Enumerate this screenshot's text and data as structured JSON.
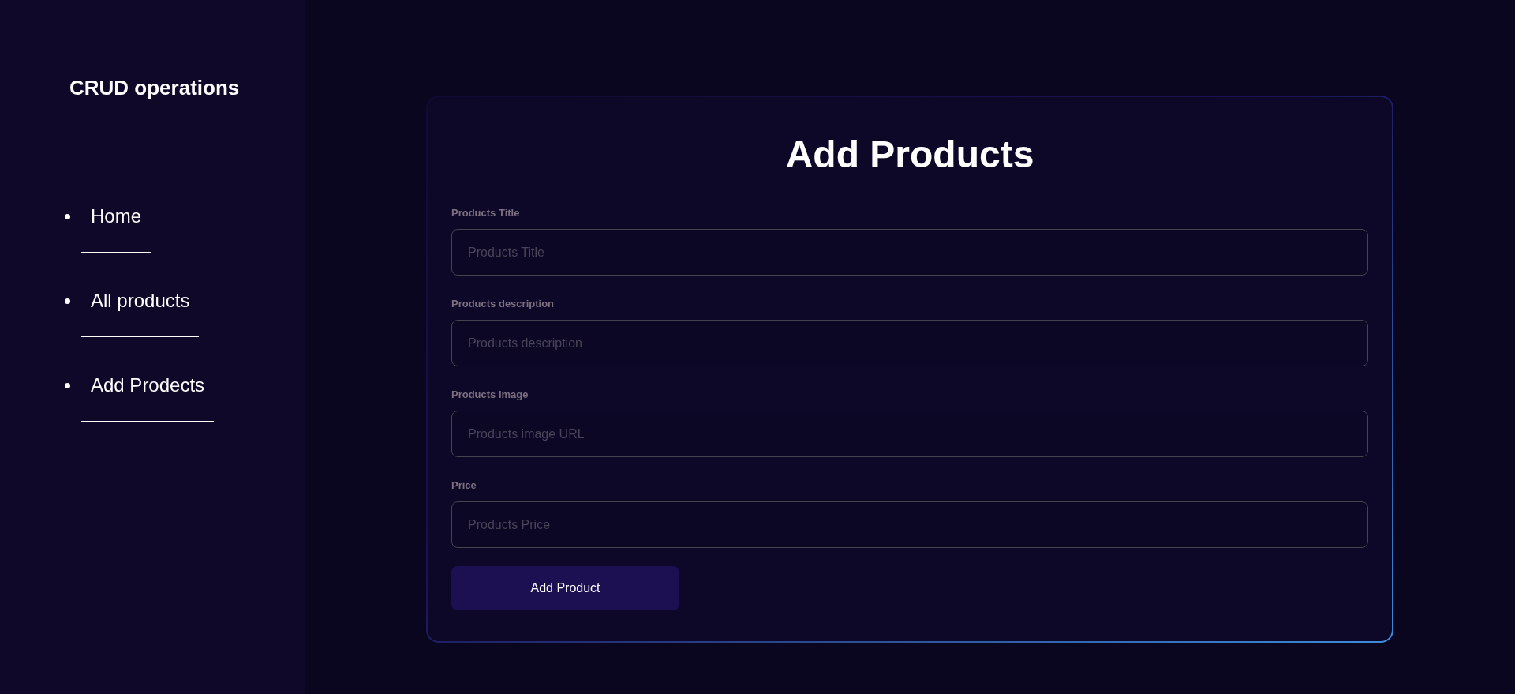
{
  "sidebar": {
    "title": "CRUD operations",
    "nav_items": [
      {
        "label": "Home"
      },
      {
        "label": "All products"
      },
      {
        "label": "Add Prodects"
      }
    ]
  },
  "form": {
    "heading": "Add Products",
    "fields": [
      {
        "label": "Products Title",
        "placeholder": "Products Title"
      },
      {
        "label": "Products description",
        "placeholder": "Products description"
      },
      {
        "label": "Products image",
        "placeholder": "Products image URL"
      },
      {
        "label": "Price",
        "placeholder": "Products Price"
      }
    ],
    "submit_button": "Add Product"
  }
}
